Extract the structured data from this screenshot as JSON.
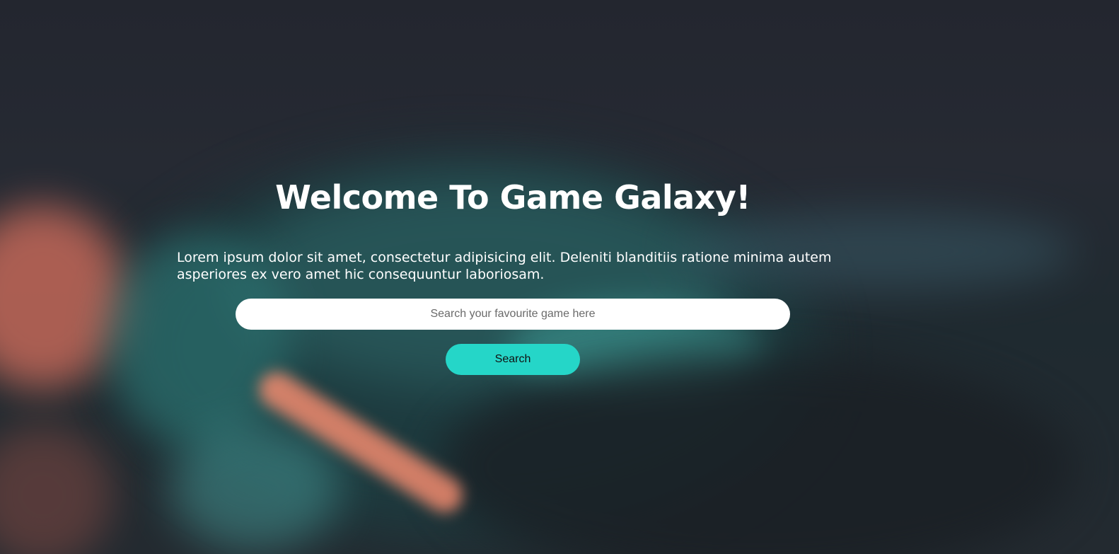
{
  "hero": {
    "title": "Welcome To Game Galaxy!",
    "description": "Lorem ipsum dolor sit amet, consectetur adipisicing elit. Deleniti blanditiis ratione minima autem asperiores ex vero amet hic consequuntur laboriosam."
  },
  "search": {
    "placeholder": "Search your favourite game here",
    "value": "",
    "button_label": "Search"
  },
  "colors": {
    "accent": "#25d6c8",
    "background": "#23262e",
    "text": "#ffffff"
  }
}
